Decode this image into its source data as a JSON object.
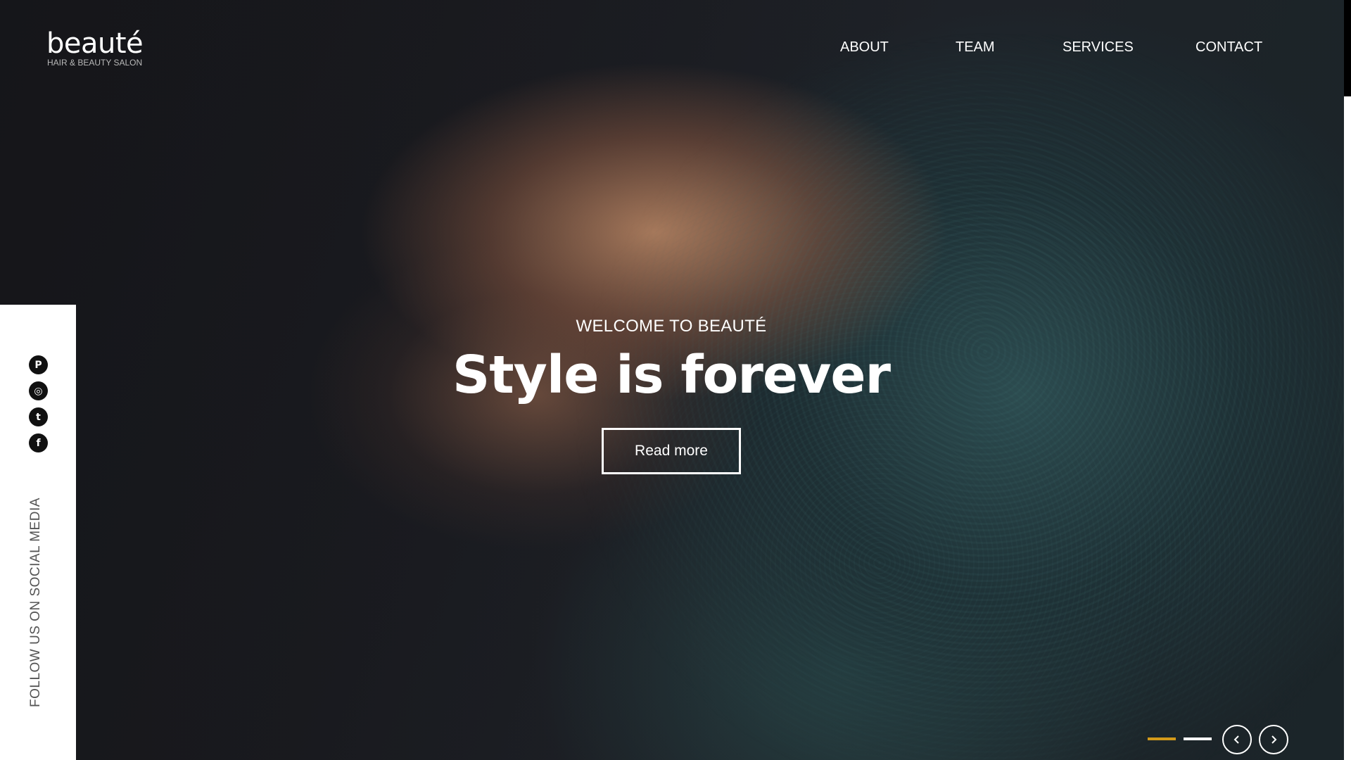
{
  "brand": {
    "name": "beauté",
    "tagline": "HAIR & BEAUTY SALON"
  },
  "nav": {
    "items": [
      {
        "label": "ABOUT"
      },
      {
        "label": "TEAM"
      },
      {
        "label": "SERVICES"
      },
      {
        "label": "CONTACT"
      }
    ]
  },
  "social": {
    "label": "FOLLOW US ON SOCIAL MEDIA",
    "icons": [
      {
        "name": "pinterest-icon",
        "glyph": "P"
      },
      {
        "name": "instagram-icon",
        "glyph": "◎"
      },
      {
        "name": "twitter-icon",
        "glyph": "t"
      },
      {
        "name": "facebook-icon",
        "glyph": "f"
      }
    ]
  },
  "hero": {
    "eyebrow": "WELCOME TO BEAUTÉ",
    "title": "Style is forever",
    "button_label": "Read more"
  },
  "slider": {
    "active_index": 1,
    "count": 2,
    "colors": {
      "active": "#d39a1a",
      "inactive": "#ffffff"
    }
  }
}
